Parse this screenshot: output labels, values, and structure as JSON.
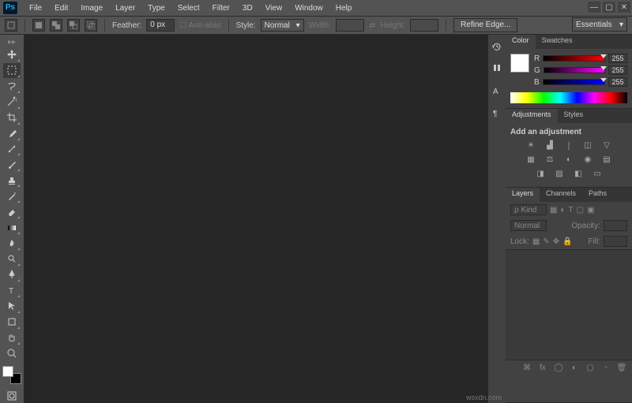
{
  "app": {
    "logo": "Ps"
  },
  "menu": [
    "File",
    "Edit",
    "Image",
    "Layer",
    "Type",
    "Select",
    "Filter",
    "3D",
    "View",
    "Window",
    "Help"
  ],
  "workspace_selector": "Essentials",
  "options": {
    "feather_label": "Feather:",
    "feather_value": "0 px",
    "antialias": "Anti-alias",
    "style_label": "Style:",
    "style_value": "Normal",
    "width_label": "Width:",
    "height_label": "Height:",
    "refine": "Refine Edge..."
  },
  "tools": [
    {
      "name": "move-tool"
    },
    {
      "name": "marquee-tool",
      "selected": true
    },
    {
      "name": "lasso-tool"
    },
    {
      "name": "wand-tool"
    },
    {
      "name": "crop-tool"
    },
    {
      "name": "eyedropper-tool"
    },
    {
      "name": "healing-tool"
    },
    {
      "name": "brush-tool"
    },
    {
      "name": "stamp-tool"
    },
    {
      "name": "history-brush-tool"
    },
    {
      "name": "eraser-tool"
    },
    {
      "name": "gradient-tool"
    },
    {
      "name": "blur-tool"
    },
    {
      "name": "dodge-tool"
    },
    {
      "name": "pen-tool"
    },
    {
      "name": "type-tool"
    },
    {
      "name": "path-select-tool"
    },
    {
      "name": "shape-tool"
    },
    {
      "name": "hand-tool"
    },
    {
      "name": "zoom-tool"
    }
  ],
  "color": {
    "tabs": [
      "Color",
      "Swatches"
    ],
    "r": {
      "label": "R",
      "val": "255"
    },
    "g": {
      "label": "G",
      "val": "255"
    },
    "b": {
      "label": "B",
      "val": "255"
    }
  },
  "adjustments": {
    "tabs": [
      "Adjustments",
      "Styles"
    ],
    "title": "Add an adjustment"
  },
  "layers": {
    "tabs": [
      "Layers",
      "Channels",
      "Paths"
    ],
    "kind": "ρ Kind",
    "blend": "Normal",
    "opacity_label": "Opacity:",
    "lock_label": "Lock:",
    "fill_label": "Fill:"
  },
  "panel_icons": [
    "history-icon",
    "char-icon",
    "para-icon",
    "brush-preset-icon"
  ],
  "watermark": "wsxdn.com"
}
